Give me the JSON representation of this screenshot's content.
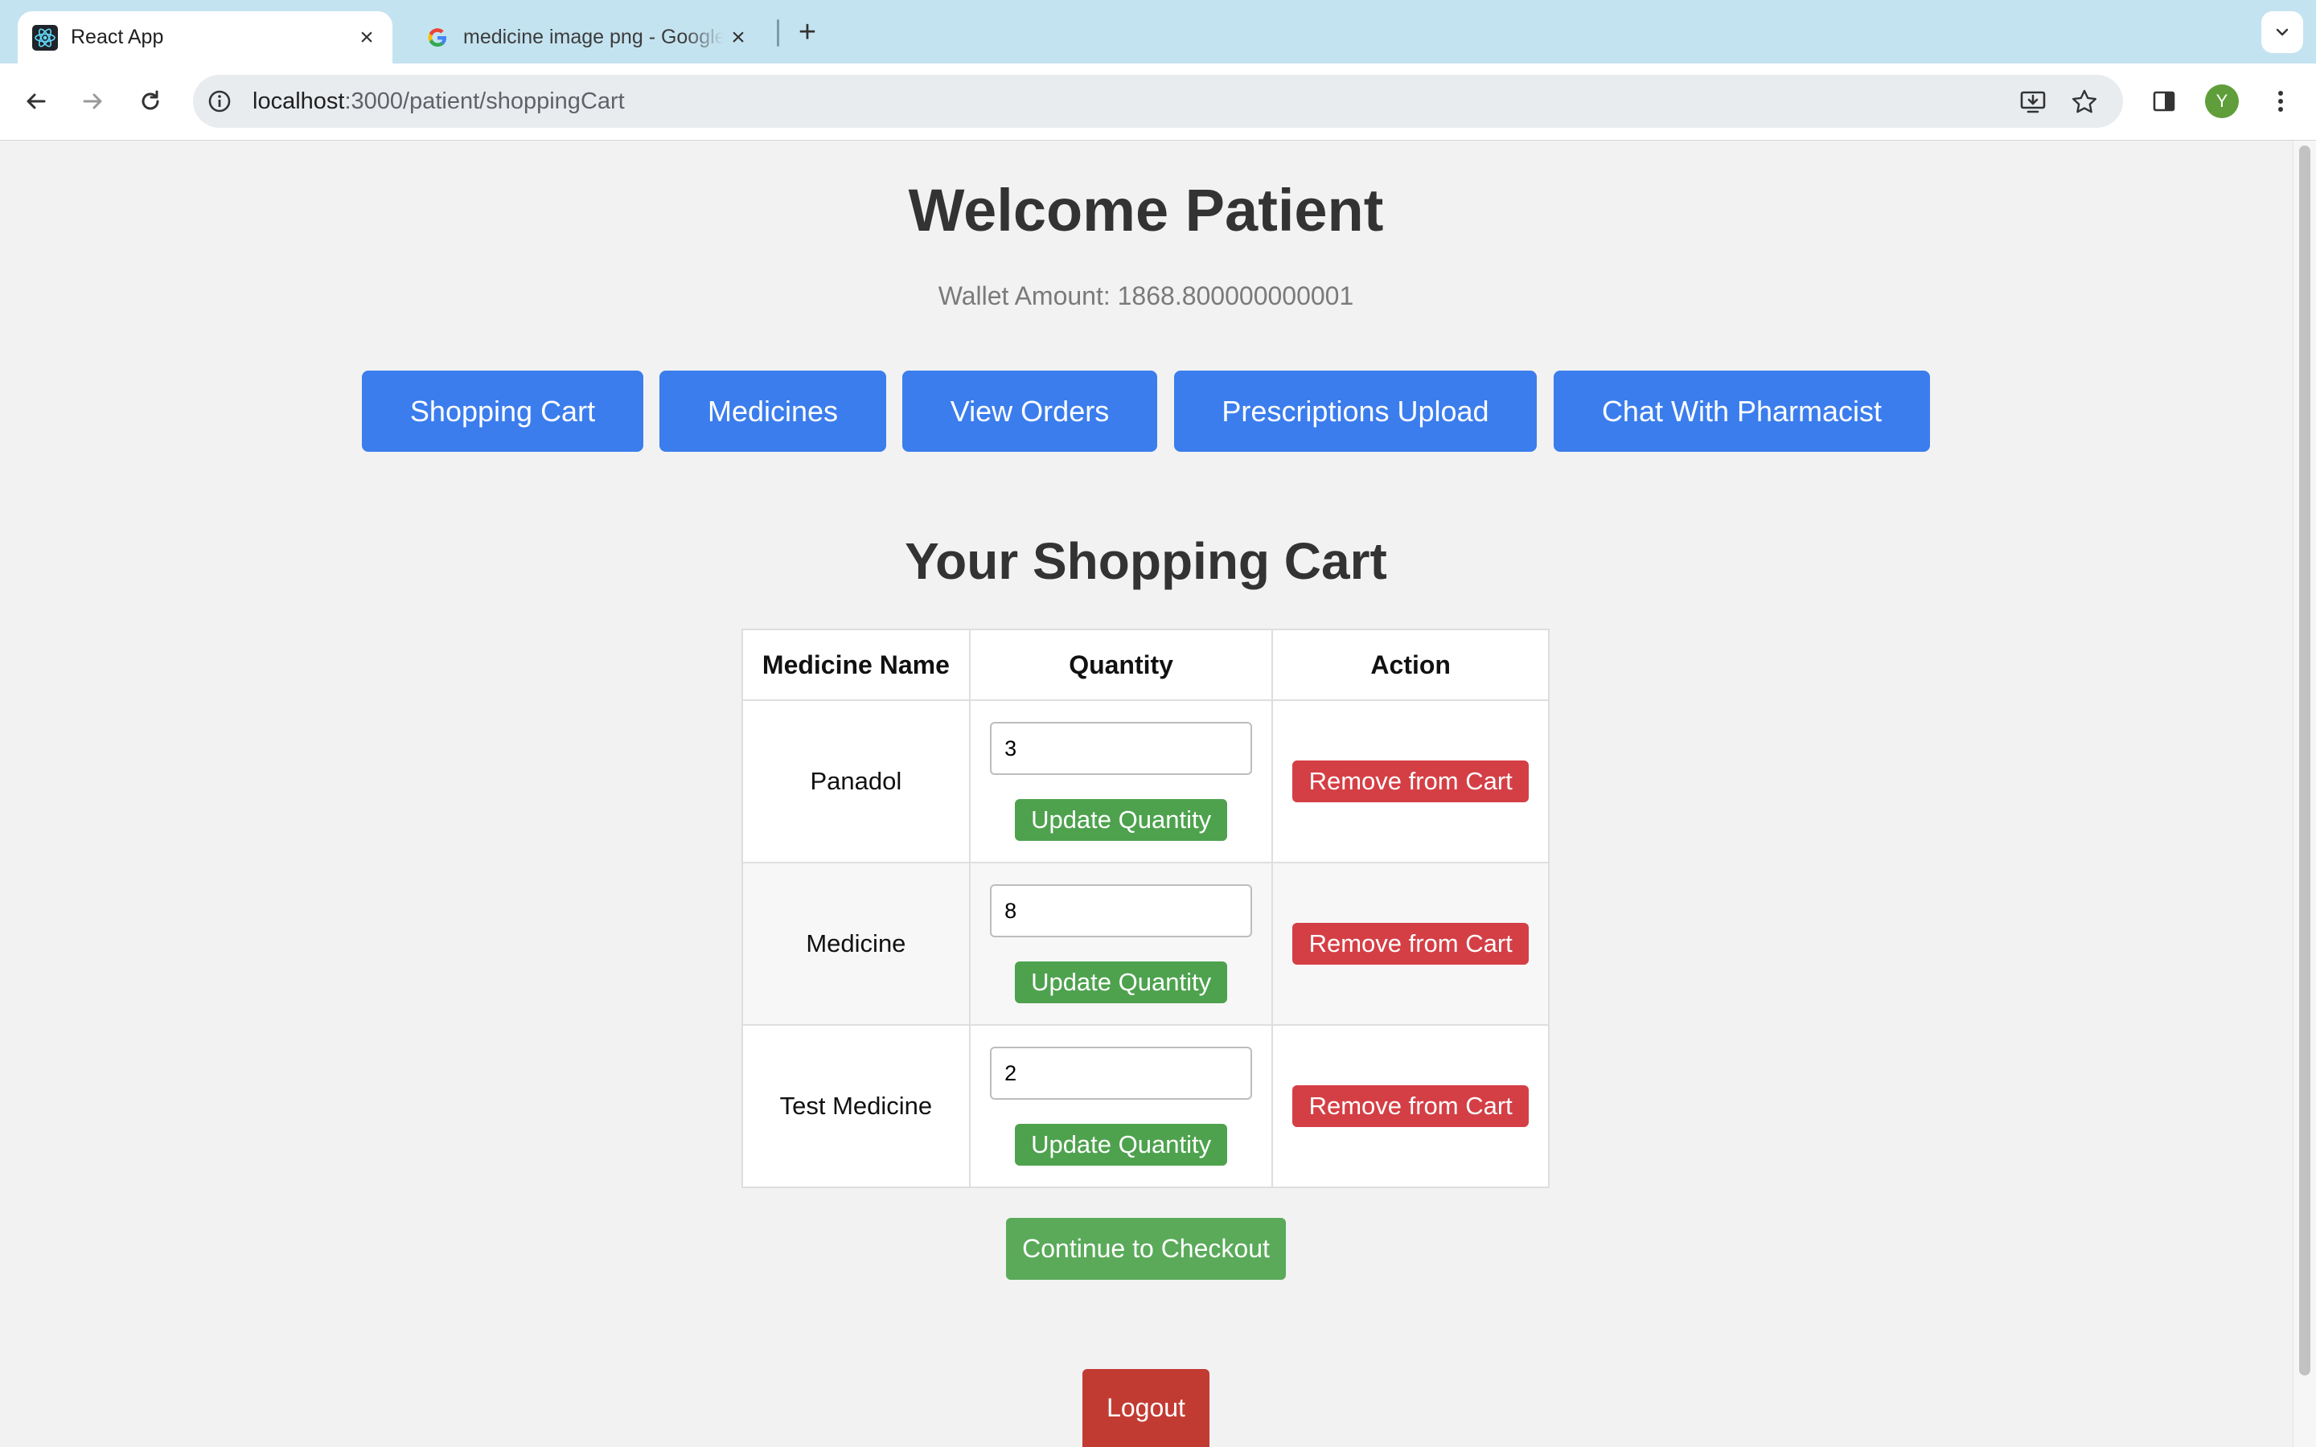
{
  "browser": {
    "tabs": [
      {
        "title": "React App",
        "active": true
      },
      {
        "title": "medicine image png - Google",
        "active": false
      }
    ],
    "url_host": "localhost",
    "url_path": ":3000/patient/shoppingCart",
    "profile_initial": "Y",
    "colors": {
      "tabstrip": "#c4e3f0",
      "profile": "#5f9e3a"
    }
  },
  "page": {
    "welcome": "Welcome Patient",
    "wallet": "Wallet Amount: 1868.800000000001",
    "nav": [
      {
        "label": "Shopping Cart"
      },
      {
        "label": "Medicines"
      },
      {
        "label": "View Orders"
      },
      {
        "label": "Prescriptions Upload"
      },
      {
        "label": "Chat With Pharmacist"
      }
    ],
    "cart_title": "Your Shopping Cart",
    "table": {
      "headers": [
        "Medicine Name",
        "Quantity",
        "Action"
      ],
      "rows": [
        {
          "name": "Panadol",
          "quantity": "3"
        },
        {
          "name": "Medicine",
          "quantity": "8"
        },
        {
          "name": "Test Medicine",
          "quantity": "2"
        }
      ],
      "update_label": "Update Quantity",
      "remove_label": "Remove from Cart"
    },
    "checkout_label": "Continue to Checkout",
    "logout_label": "Logout",
    "colors": {
      "primary": "#3b7ded",
      "success": "#4ea24e",
      "danger": "#d43f45",
      "logout": "#c23b33"
    }
  }
}
